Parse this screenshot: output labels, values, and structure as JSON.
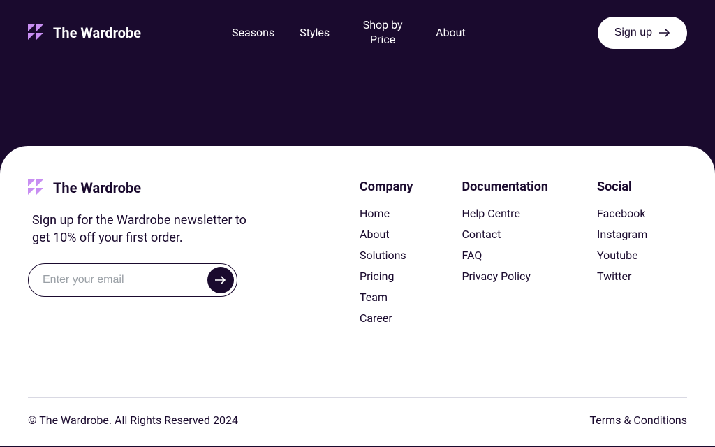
{
  "brand": "The Wardrobe",
  "nav": {
    "seasons": "Seasons",
    "styles": "Styles",
    "shop_by_price": "Shop by Price",
    "about": "About"
  },
  "signup_label": "Sign up",
  "footer": {
    "newsletter_text": "Sign up for the Wardrobe newsletter to get 10% off your first order.",
    "email_placeholder": "Enter your email",
    "columns": {
      "company": {
        "title": "Company",
        "links": [
          "Home",
          "About",
          "Solutions",
          "Pricing",
          "Team",
          "Career"
        ]
      },
      "documentation": {
        "title": "Documentation",
        "links": [
          "Help Centre",
          "Contact",
          "FAQ",
          "Privacy Policy"
        ]
      },
      "social": {
        "title": "Social",
        "links": [
          "Facebook",
          "Instagram",
          "Youtube",
          "Twitter"
        ]
      }
    },
    "copyright": "© The Wardrobe. All Rights Reserved 2024",
    "terms": "Terms & Conditions"
  }
}
